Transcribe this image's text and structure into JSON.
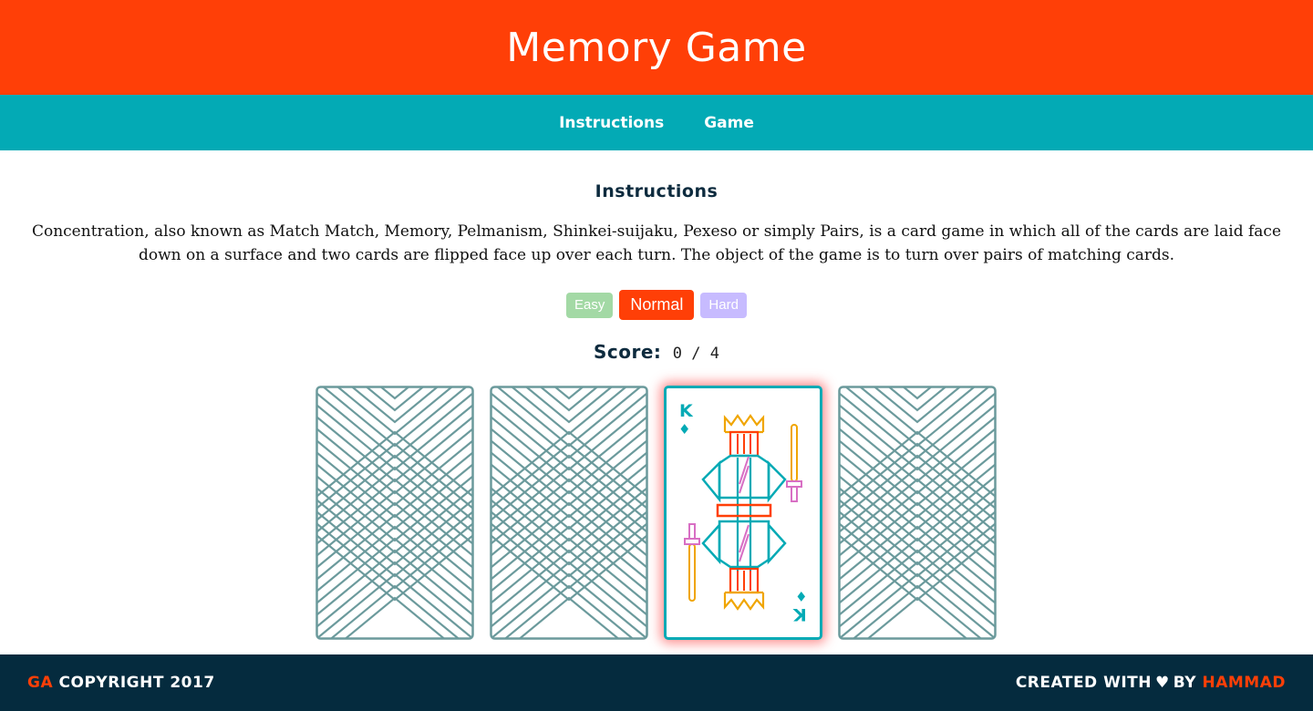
{
  "header": {
    "title": "Memory Game"
  },
  "nav": {
    "items": [
      {
        "label": "Instructions"
      },
      {
        "label": "Game"
      }
    ]
  },
  "instructions": {
    "title": "Instructions",
    "text": "Concentration, also known as Match Match, Memory, Pelmanism, Shinkei-suijaku, Pexeso or simply Pairs, is a card game in which all of the cards are laid face down on a surface and two cards are flipped face up over each turn. The object of the game is to turn over pairs of matching cards."
  },
  "difficulty": {
    "easy": "Easy",
    "normal": "Normal",
    "hard": "Hard",
    "selected": "Normal"
  },
  "score": {
    "label": "Score:",
    "value": "0 / 4"
  },
  "cards": {
    "items": [
      {
        "state": "face-down"
      },
      {
        "state": "face-down"
      },
      {
        "state": "face-up",
        "rank": "K",
        "suit": "♦"
      },
      {
        "state": "face-down"
      }
    ]
  },
  "footer": {
    "left_accent": "GA",
    "left_text": "COPYRIGHT 2017",
    "right_text_1": "CREATED WITH",
    "heart_icon": "heart-icon",
    "right_text_2": "BY",
    "right_accent": "HAMMAD"
  },
  "colors": {
    "header": "#ff3f07",
    "nav": "#03aab5",
    "footer": "#052b3e",
    "card_back_lines": "#6b9a9c",
    "accent": "#ff3f07"
  }
}
